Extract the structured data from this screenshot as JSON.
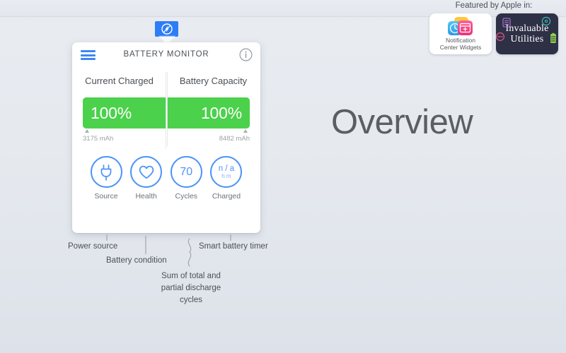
{
  "menubar": {
    "app_icon": "bolt-circle-icon"
  },
  "card": {
    "menu_icon": "hamburger-menu-icon",
    "title": "BATTERY MONITOR",
    "info_icon": "info-circle-icon",
    "gauges": [
      {
        "label": "Current Charged",
        "value": "100%",
        "capacity": "3175 mAh"
      },
      {
        "label": "Battery Capacity",
        "value": "100%",
        "capacity": "8482 mAh"
      }
    ],
    "stats": [
      {
        "icon": "power-plug-icon",
        "value": "",
        "sub": "",
        "caption": "Source"
      },
      {
        "icon": "heart-icon",
        "value": "",
        "sub": "",
        "caption": "Health"
      },
      {
        "icon": "cycles-count",
        "value": "70",
        "sub": "",
        "caption": "Cycles"
      },
      {
        "icon": "charge-timer",
        "value": "n / a",
        "sub": "h:m",
        "caption": "Charged"
      }
    ]
  },
  "annotations": [
    {
      "text": "Power source"
    },
    {
      "text": "Battery condition"
    },
    {
      "text": "Smart battery timer"
    },
    {
      "text": "Sum of total and partial discharge cycles"
    }
  ],
  "annotation_lines": {
    "sum_line1": "Sum of total and",
    "sum_line2": "partial discharge",
    "sum_line3": "cycles"
  },
  "heading": {
    "text": "Overview"
  },
  "featured": {
    "title": "Featured by Apple in:",
    "badges": [
      {
        "type": "light",
        "caption_line1": "Notification",
        "caption_line2": "Center Widgets"
      },
      {
        "type": "dark",
        "line1": "Invaluable",
        "line2": "Utilities"
      }
    ]
  },
  "colors": {
    "accent_blue": "#4d94f7",
    "menubar_blue": "#2d7df6",
    "gauge_green": "#4bd14b",
    "background": "#dfe3ea",
    "badge_dark": "#2e3045"
  }
}
